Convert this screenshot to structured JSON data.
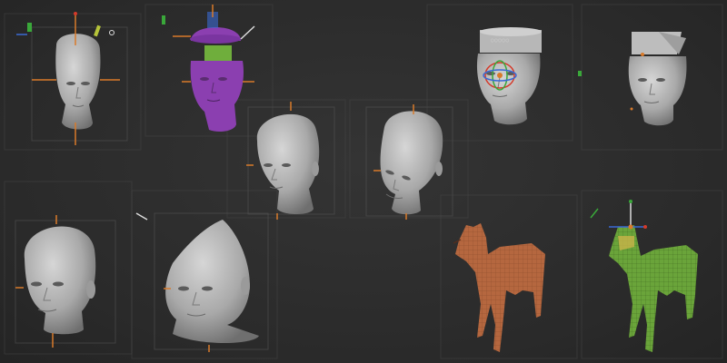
{
  "viewport": {
    "title": "",
    "background": "#2b2b2b"
  },
  "colors": {
    "skin": "#b9b9b9",
    "skin_shadow": "#7c7c7c",
    "mask_purple": "#8b3fb0",
    "mask_green": "#6fae3c",
    "dog_orange": "#b5673f",
    "dog_green": "#6aa43a",
    "gizmo_orange": "#d97a2a",
    "gizmo_red": "#d43a2a",
    "gizmo_green": "#3aa83a",
    "gizmo_blue": "#3a6ad4"
  },
  "panels": [
    {
      "id": "head-transform-gizmo",
      "subject": "female-head",
      "state": "transform-gizmo"
    },
    {
      "id": "head-mask-split",
      "subject": "female-head",
      "state": "masked-purple-green"
    },
    {
      "id": "head-default",
      "subject": "female-head",
      "state": "default"
    },
    {
      "id": "head-tilted",
      "subject": "female-head",
      "state": "rotated"
    },
    {
      "id": "head-rotate-gizmo",
      "subject": "female-head",
      "state": "rotate-gizmo-with-cap"
    },
    {
      "id": "head-with-cap",
      "subject": "female-head",
      "state": "extruded-cap"
    },
    {
      "id": "head-stretched-bottom-left",
      "subject": "female-head",
      "state": "default"
    },
    {
      "id": "head-cone",
      "subject": "female-head",
      "state": "cone-deformed"
    },
    {
      "id": "dog-orange",
      "subject": "dog",
      "state": "polygroups-orange"
    },
    {
      "id": "dog-green",
      "subject": "dog",
      "state": "masked-green"
    }
  ],
  "gizmo_text": "○○○○○"
}
